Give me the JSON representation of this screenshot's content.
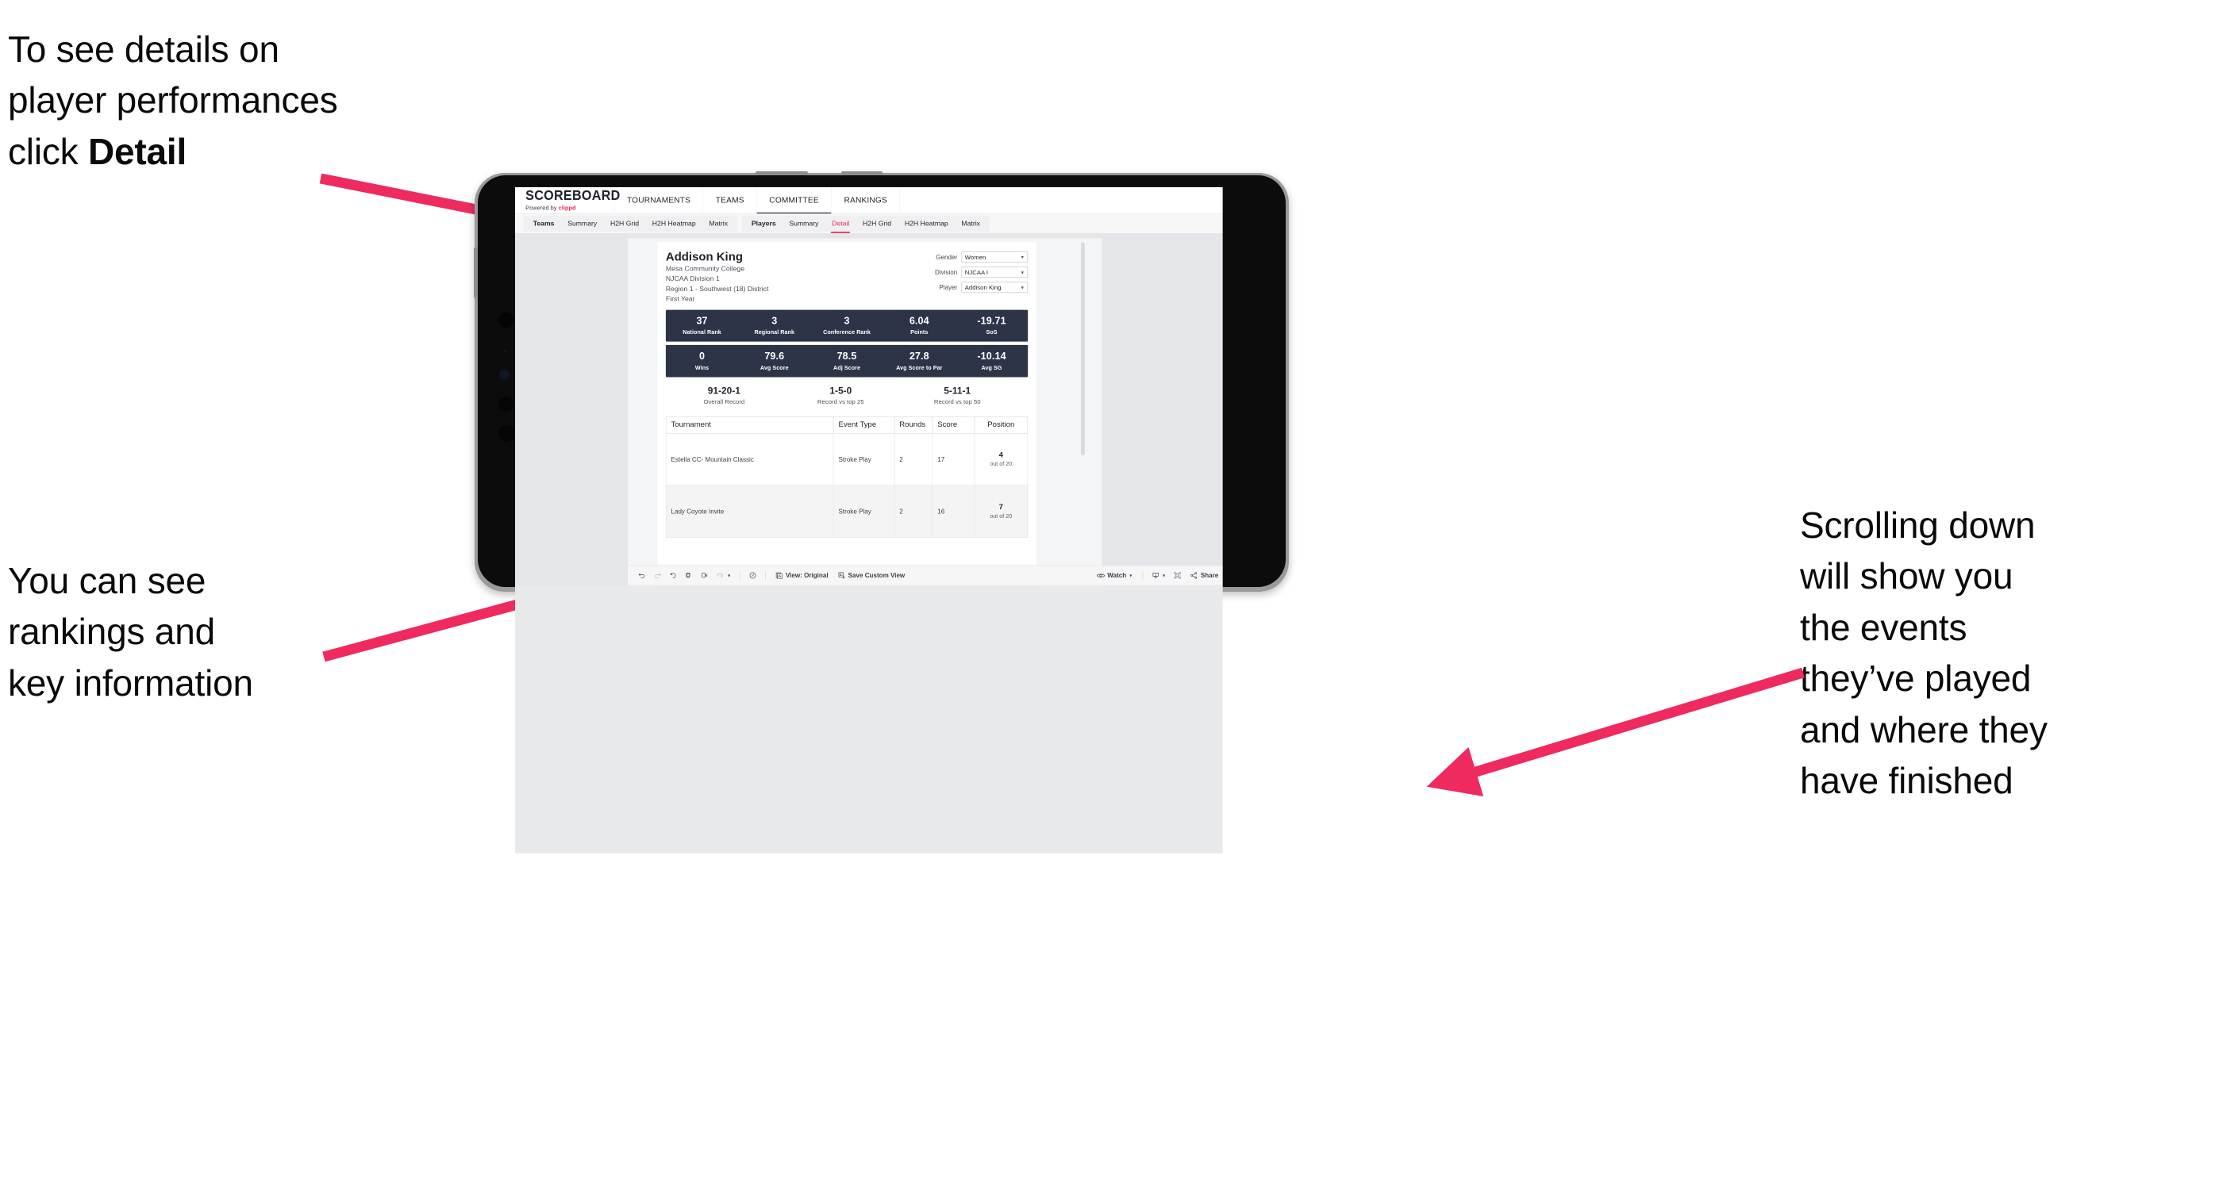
{
  "annotations": {
    "top_left": "To see details on\nplayer performances\nclick ",
    "top_left_bold": "Detail",
    "mid_left": "You can see\nrankings and\nkey information",
    "right": "Scrolling down\nwill show you\nthe events\nthey’ve played\nand where they\nhave finished"
  },
  "colors": {
    "accent_pink": "#ea2a5f",
    "arrow_pink": "#ee2a5f",
    "stat_navy": "#2e3448",
    "canvas_gray": "#e4e6e9"
  },
  "app": {
    "brand": {
      "title": "SCOREBOARD",
      "powered_prefix": "Powered by ",
      "powered_name": "clippd"
    },
    "topnav": [
      {
        "label": "TOURNAMENTS",
        "active": false
      },
      {
        "label": "TEAMS",
        "active": false
      },
      {
        "label": "COMMITTEE",
        "active": true
      },
      {
        "label": "RANKINGS",
        "active": false
      }
    ],
    "subnav_left": [
      {
        "label": "Teams",
        "lead": true,
        "active": false
      },
      {
        "label": "Summary",
        "lead": false,
        "active": false
      },
      {
        "label": "H2H Grid",
        "lead": false,
        "active": false
      },
      {
        "label": "H2H Heatmap",
        "lead": false,
        "active": false
      },
      {
        "label": "Matrix",
        "lead": false,
        "active": false
      }
    ],
    "subnav_right": [
      {
        "label": "Players",
        "lead": true,
        "active": false
      },
      {
        "label": "Summary",
        "lead": false,
        "active": false
      },
      {
        "label": "Detail",
        "lead": false,
        "active": true
      },
      {
        "label": "H2H Grid",
        "lead": false,
        "active": false
      },
      {
        "label": "H2H Heatmap",
        "lead": false,
        "active": false
      },
      {
        "label": "Matrix",
        "lead": false,
        "active": false
      }
    ]
  },
  "player": {
    "name": "Addison King",
    "school": "Mesa Community College",
    "division": "NJCAA Division 1",
    "region": "Region 1 - Southwest (18) District",
    "year": "First Year"
  },
  "filters": [
    {
      "label": "Gender",
      "value": "Women"
    },
    {
      "label": "Division",
      "value": "NJCAA I"
    },
    {
      "label": "Player",
      "value": "Addison King"
    }
  ],
  "stats_row_1": [
    {
      "value": "37",
      "label": "National Rank"
    },
    {
      "value": "3",
      "label": "Regional Rank"
    },
    {
      "value": "3",
      "label": "Conference Rank"
    },
    {
      "value": "6.04",
      "label": "Points"
    },
    {
      "value": "-19.71",
      "label": "SoS"
    }
  ],
  "stats_row_2": [
    {
      "value": "0",
      "label": "Wins"
    },
    {
      "value": "79.6",
      "label": "Avg Score"
    },
    {
      "value": "78.5",
      "label": "Adj Score"
    },
    {
      "value": "27.8",
      "label": "Avg Score to Par"
    },
    {
      "value": "-10.14",
      "label": "Avg SG"
    }
  ],
  "records": [
    {
      "value": "91-20-1",
      "label": "Overall Record"
    },
    {
      "value": "1-5-0",
      "label": "Record vs top 25"
    },
    {
      "value": "5-11-1",
      "label": "Record vs top 50"
    }
  ],
  "events_table": {
    "headers": [
      "Tournament",
      "Event Type",
      "Rounds",
      "Score",
      "Position"
    ],
    "rows": [
      {
        "tournament": "Estella CC- Mountain Classic",
        "event_type": "Stroke Play",
        "rounds": "2",
        "score": "17",
        "position_num": "4",
        "position_sub": "out of 20"
      },
      {
        "tournament": "Lady Coyote Invite",
        "event_type": "Stroke Play",
        "rounds": "2",
        "score": "16",
        "position_num": "7",
        "position_sub": "out of 20"
      }
    ]
  },
  "toolbar": {
    "icons": [
      "undo-icon",
      "redo-icon",
      "revert-icon",
      "refresh-data-icon",
      "pause-autoupdate-icon",
      "loop-icon"
    ],
    "view_label": "View: Original",
    "save_label": "Save Custom View",
    "watch_label": "Watch",
    "share_label": "Share"
  }
}
